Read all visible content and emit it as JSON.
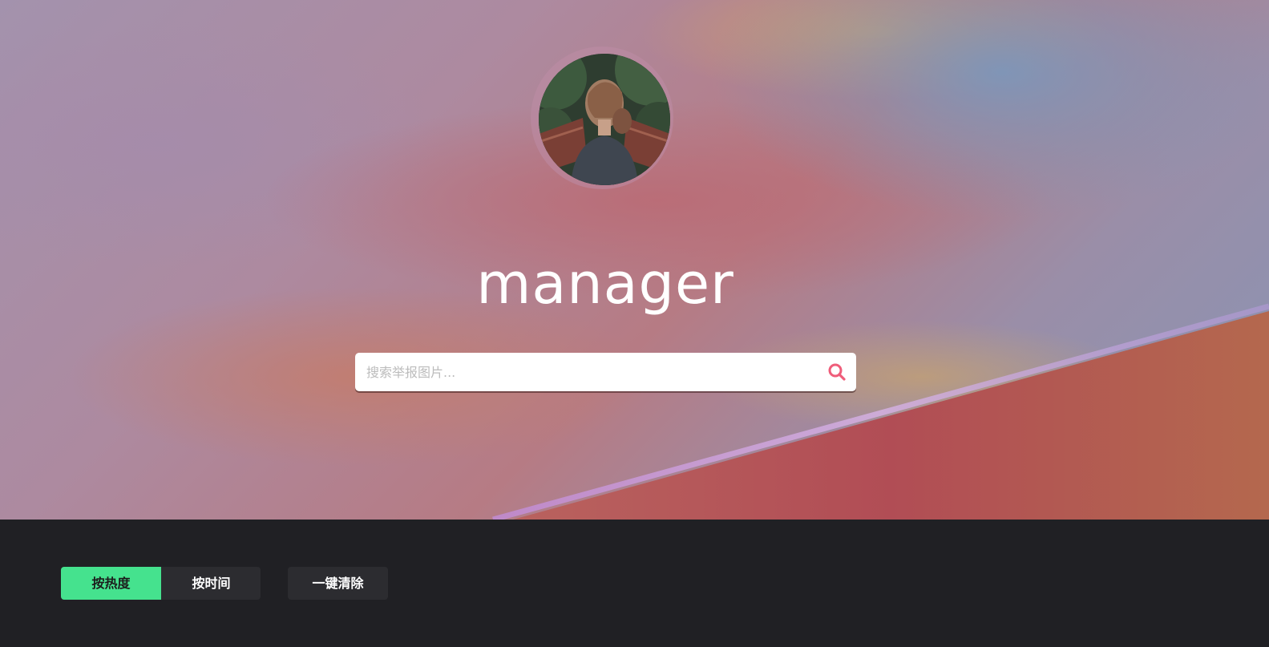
{
  "header": {
    "username": "manager",
    "avatar_icon": "avatar-photo-woman-icon"
  },
  "search": {
    "placeholder": "搜索举报图片...",
    "value": "",
    "button_icon": "search-icon",
    "icon_color": "#ef5d7a"
  },
  "sort": {
    "options": [
      {
        "label": "按热度",
        "active": true
      },
      {
        "label": "按时间",
        "active": false
      }
    ],
    "active_color": "#45e28e"
  },
  "actions": {
    "clear_label": "一键清除"
  }
}
